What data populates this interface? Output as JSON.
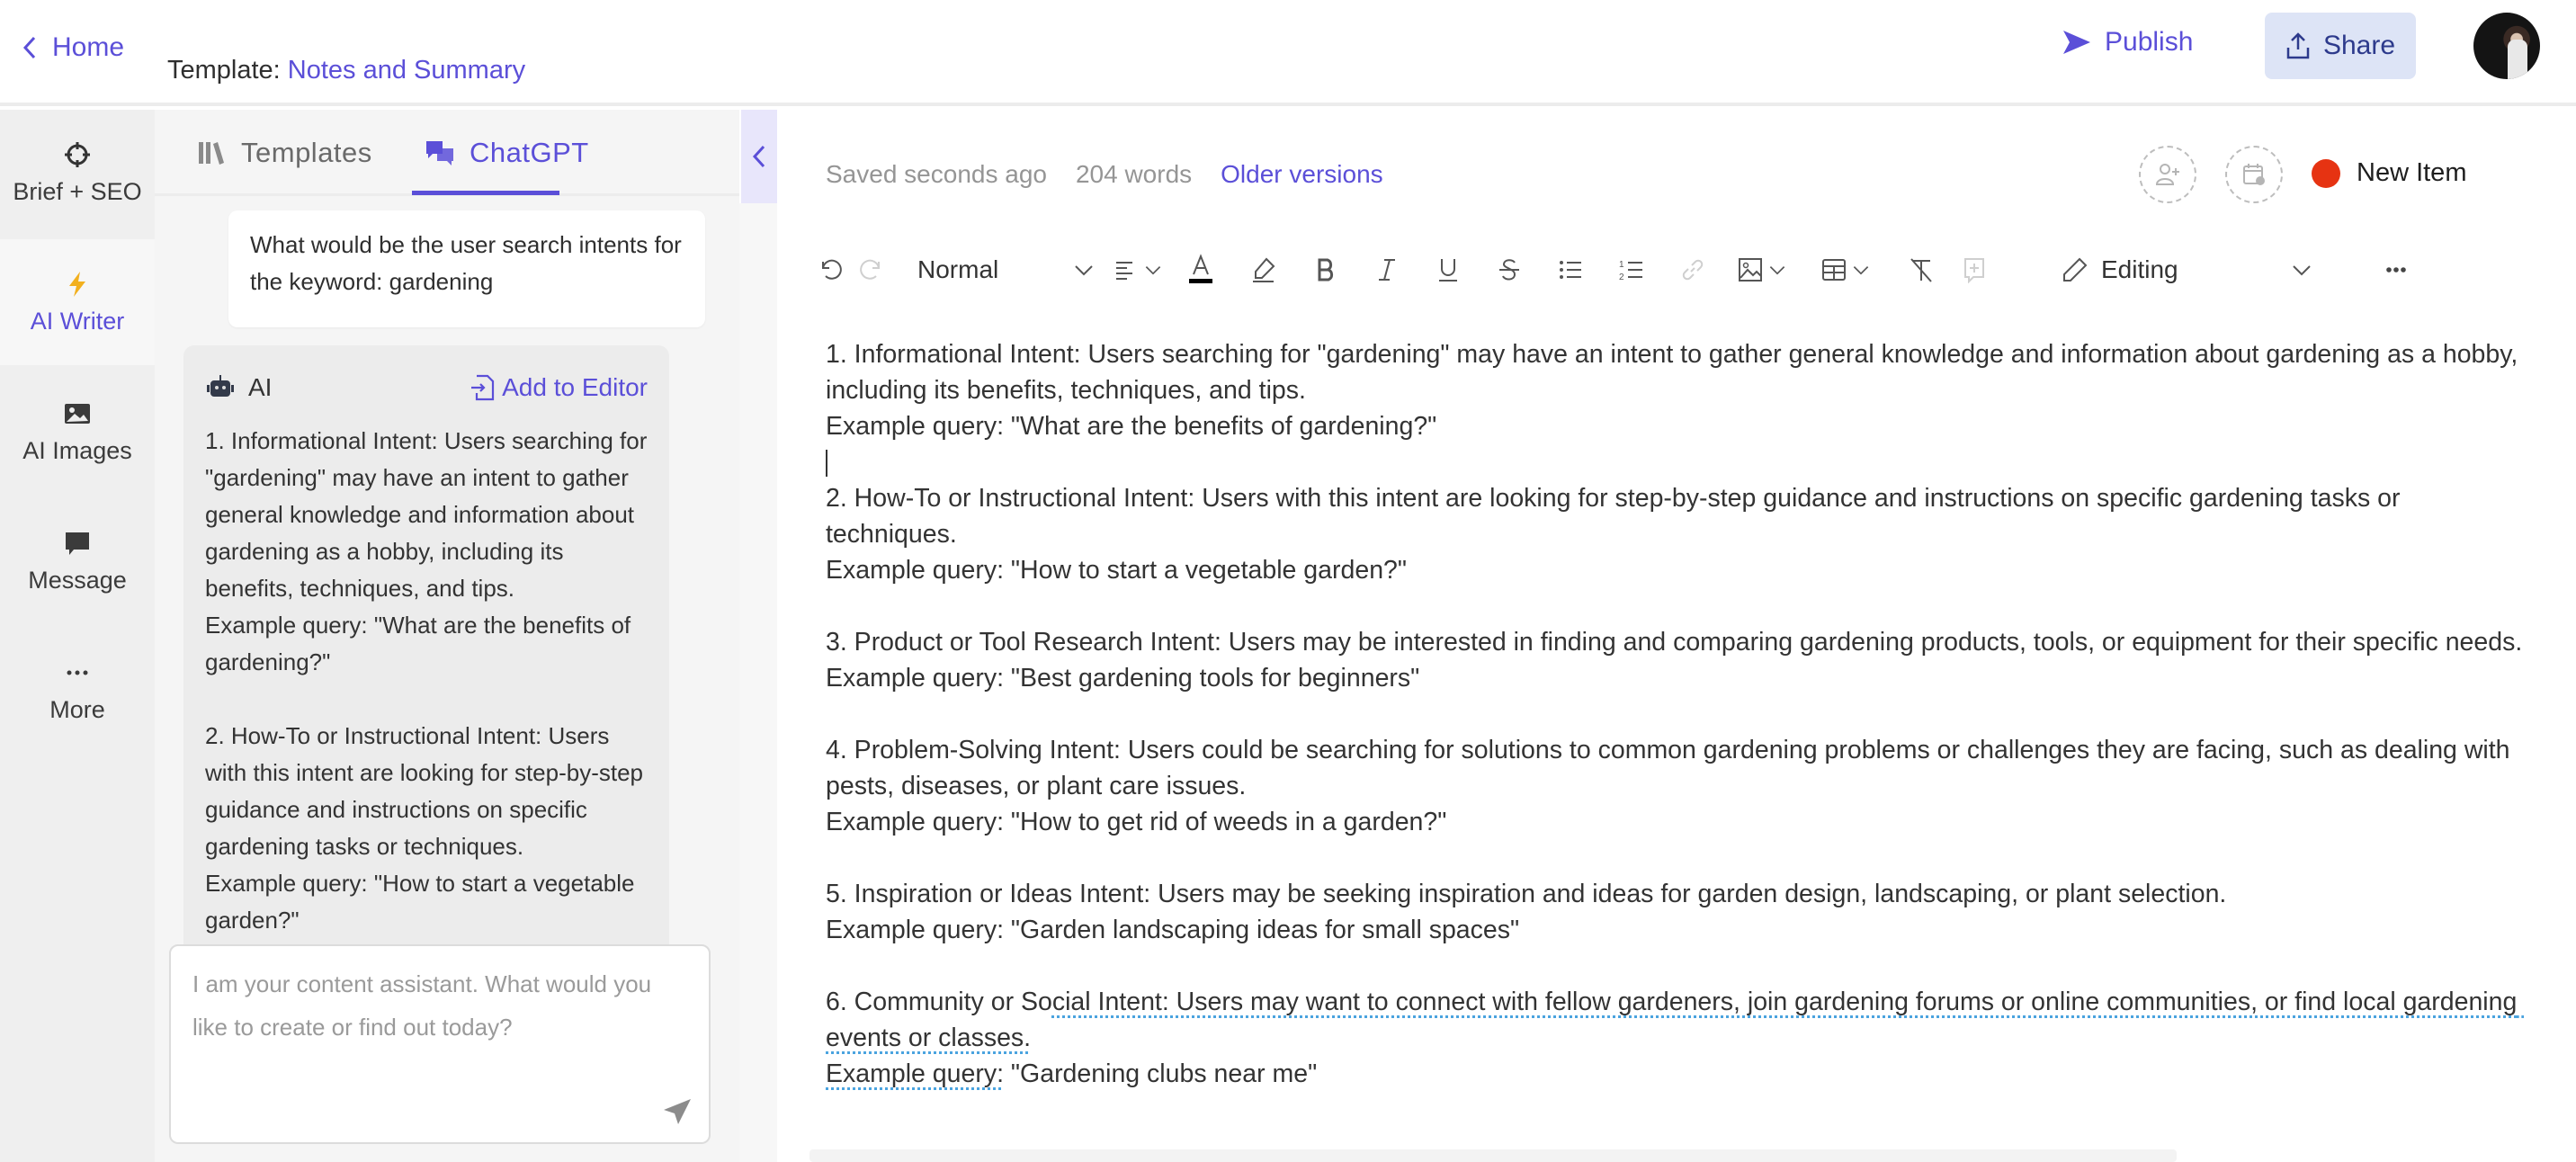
{
  "header": {
    "home_label": "Home",
    "template_prefix": "Template:",
    "template_name": "Notes and Summary",
    "publish_label": "Publish",
    "share_label": "Share",
    "avatar_alt": "User avatar"
  },
  "rail": {
    "items": [
      {
        "label": "Brief + SEO",
        "icon": "crosshair-icon",
        "active": false
      },
      {
        "label": "AI Writer",
        "icon": "lightning-icon",
        "active": true
      },
      {
        "label": "AI Images",
        "icon": "image-icon",
        "active": false
      },
      {
        "label": "Message",
        "icon": "message-icon",
        "active": false
      },
      {
        "label": "More",
        "icon": "more-dots-icon",
        "active": false
      }
    ]
  },
  "chat": {
    "tabs": [
      {
        "label": "Templates",
        "active": false
      },
      {
        "label": "ChatGPT",
        "active": true
      }
    ],
    "user_message": "What would be the user search intents for the keyword: gardening",
    "ai_name": "AI",
    "add_to_editor_label": "Add to Editor",
    "ai_response": "1. Informational Intent: Users searching for \"gardening\" may have an intent to gather general knowledge and information about gardening as a hobby, including its benefits, techniques, and tips.\nExample query: \"What are the benefits of gardening?\"\n\n2. How-To or Instructional Intent: Users with this intent are looking for step-by-step guidance and instructions on specific gardening tasks or techniques.\nExample query: \"How to start a vegetable garden?\"",
    "input_placeholder": "I am your content assistant. What would you like to create or find out today?",
    "input_value": ""
  },
  "editor": {
    "saved_status": "Saved seconds ago",
    "word_count": "204 words",
    "older_versions_label": "Older versions",
    "status_label": "New Item",
    "status_color": "#e63312",
    "toolbar": {
      "text_style": "Normal",
      "mode": "Editing",
      "text_color": "#000000"
    },
    "paragraphs": [
      "1. Informational Intent: Users searching for \"gardening\" may have an intent to gather general knowledge and information about gardening as a hobby, including its benefits, techniques, and tips.",
      "Example query: \"What are the benefits of gardening?\"",
      "",
      "2. How-To or Instructional Intent: Users with this intent are looking for step-by-step guidance and instructions on specific gardening tasks or techniques.",
      "Example query: \"How to start a vegetable garden?\"",
      "",
      "3. Product or Tool Research Intent: Users may be interested in finding and comparing gardening products, tools, or equipment for their specific needs.",
      "Example query: \"Best gardening tools for beginners\"",
      "",
      "4. Problem-Solving Intent: Users could be searching for solutions to common gardening problems or challenges they are facing, such as dealing with pests, diseases, or plant care issues.",
      "Example query: \"How to get rid of weeds in a garden?\"",
      "",
      "5. Inspiration or Ideas Intent: Users may be seeking inspiration and ideas for garden design, landscaping, or plant selection.",
      "Example query: \"Garden landscaping ideas for small spaces\"",
      ""
    ],
    "last_paragraph": {
      "plain_start": "6. Community or So",
      "underlined": "cial Intent: Users may want to connect with fellow gardeners, join gardening forums or online communities, or find local gardening events or classes.",
      "example_underlined": "Example query:",
      "example_rest": " \"Gardening clubs near me\""
    }
  },
  "colors": {
    "accent": "#5b4fd8",
    "share_bg": "#dde4f6",
    "rail_bg": "#efefef",
    "panel_bg": "#f5f5f5"
  }
}
